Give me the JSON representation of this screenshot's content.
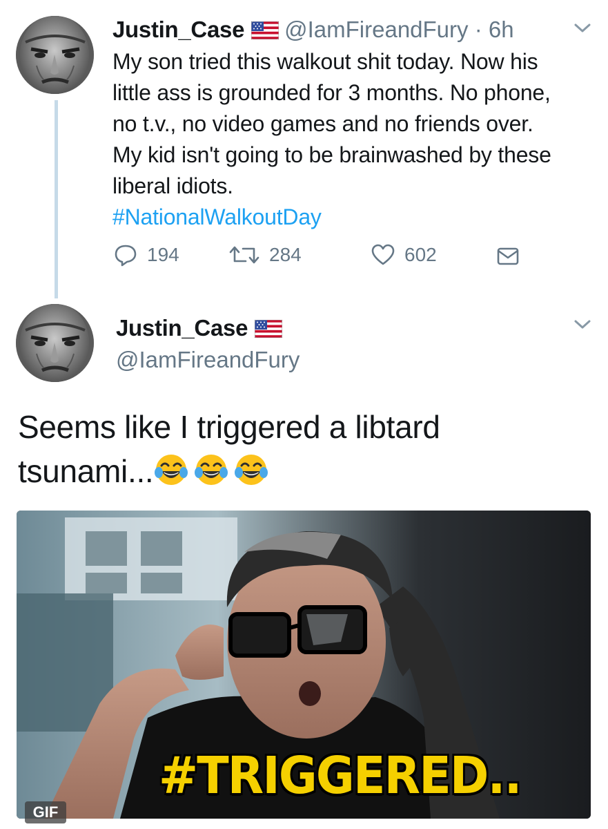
{
  "tweet1": {
    "display_name": "Justin_Case",
    "handle_time": "@IamFireandFury · 6h",
    "text_lines": [
      "My son tried this walkout shit today. Now his",
      "little ass is grounded for 3 months. No phone,",
      "no t.v., no video games and no friends over.",
      "My kid isn't going to be brainwashed by these",
      "liberal idiots."
    ],
    "hashtag": "#NationalWalkoutDay",
    "actions": {
      "replies": "194",
      "retweets": "284",
      "likes": "602"
    }
  },
  "tweet2": {
    "display_name": "Justin_Case",
    "handle": "@IamFireandFury",
    "text_line1": "Seems like I triggered a libtard",
    "text_line2": "tsunami...",
    "emoji": "face-with-tears-of-joy x3",
    "media": {
      "caption": "#TRIGGERED..",
      "badge": "GIF"
    }
  },
  "icons": {
    "flag": "us-flag-icon",
    "chevron": "chevron-down-icon",
    "reply": "reply-icon",
    "retweet": "retweet-icon",
    "like": "heart-icon",
    "dm": "envelope-icon"
  },
  "colors": {
    "link": "#1da1f2",
    "secondary": "#657786",
    "thread_line": "#c6dae8",
    "caption": "#f5d000"
  }
}
